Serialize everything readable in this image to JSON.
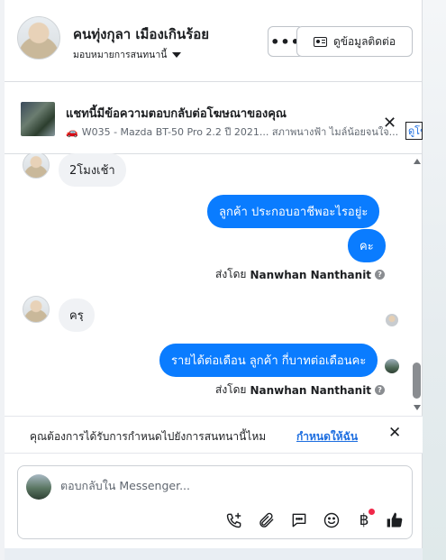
{
  "header": {
    "contact_name": "คนทุ่งกุลา เมืองเกินร้อย",
    "assignee": "มอบหมายการสนทนานี้",
    "more_label": "•••",
    "contact_info_label": "ดูข้อมูลติดต่อ"
  },
  "ad_banner": {
    "title": "แชทนี้มีข้อความตอบกลับต่อโฆษณาของคุณ",
    "subtitle": "W035 - Mazda BT-50 Pro 2.2 ปี 2021... สภาพนางฟ้า ไมล์น้อยจนใจ...",
    "view_link": "ดูโฆษณา"
  },
  "messages": [
    {
      "direction": "in",
      "text": "2โมงเช้า"
    },
    {
      "direction": "out",
      "text": "ลูกค้า  ประกอบอาชีพอะไรอยู่ะ"
    },
    {
      "direction": "out",
      "text": "คะ"
    },
    {
      "type": "sent_by",
      "prefix": "ส่งโดย",
      "name": "Nanwhan Nanthanit"
    },
    {
      "direction": "in",
      "text": "ครฺ"
    },
    {
      "direction": "out",
      "text": "รายได้ต่อเดือน  ลูกค้า กี่บาทต่อเดือนคะ"
    },
    {
      "type": "sent_by",
      "prefix": "ส่งโดย",
      "name": "Nanwhan Nanthanit"
    }
  ],
  "reminder": {
    "text": "คุณต้องการได้รับการกำหนดไปยังการสนทนานี้ไหม",
    "link": "กำหนดให้ฉัน"
  },
  "composer": {
    "placeholder": "ตอบกลับใน Messenger...",
    "tools": [
      "call-add-icon",
      "attach-icon",
      "saved-reply-icon",
      "emoji-icon",
      "baht-payment-icon",
      "like-icon"
    ],
    "baht_symbol": "฿"
  },
  "colors": {
    "outgoing_bubble": "#0a7cff",
    "incoming_bubble": "#f0f2f5",
    "link": "#1d6ee0",
    "notification_dot": "#f02849"
  }
}
